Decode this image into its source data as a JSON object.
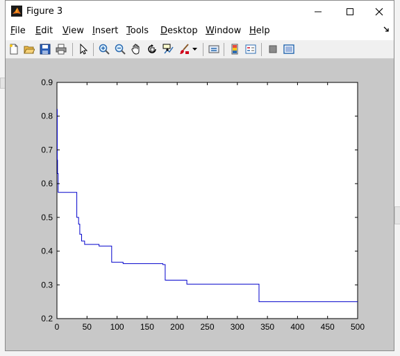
{
  "window": {
    "title": "Figure 3",
    "controls": [
      "minimize",
      "maximize",
      "close"
    ]
  },
  "menu": {
    "items": [
      {
        "label": "File",
        "mnemonic": "F",
        "rest": "ile"
      },
      {
        "label": "Edit",
        "mnemonic": "E",
        "rest": "dit"
      },
      {
        "label": "View",
        "mnemonic": "V",
        "rest": "iew"
      },
      {
        "label": "Insert",
        "mnemonic": "I",
        "rest": "nsert"
      },
      {
        "label": "Tools",
        "mnemonic": "T",
        "rest": "ools"
      },
      {
        "label": "Desktop",
        "mnemonic": "D",
        "rest": "esktop"
      },
      {
        "label": "Window",
        "mnemonic": "W",
        "rest": "indow"
      },
      {
        "label": "Help",
        "mnemonic": "H",
        "rest": "elp"
      }
    ]
  },
  "toolbar": {
    "icons": [
      "new-figure-icon",
      "open-file-icon",
      "save-icon",
      "print-icon",
      "edit-plot-arrow-icon",
      "zoom-in-icon",
      "zoom-out-icon",
      "pan-hand-icon",
      "rotate-3d-icon",
      "data-cursor-icon",
      "brush-icon",
      "brush-dropdown-icon",
      "link-plot-icon",
      "colorbar-icon",
      "legend-icon",
      "hide-plot-tools-icon",
      "show-plot-tools-icon"
    ]
  },
  "colors": {
    "line": "#0000cc",
    "figure_bg": "#c8c8c8",
    "axes_bg": "#ffffff"
  },
  "chart_data": {
    "type": "line",
    "title": "",
    "xlabel": "",
    "ylabel": "",
    "xlim": [
      0,
      500
    ],
    "ylim": [
      0.2,
      0.9
    ],
    "xticks": [
      0,
      50,
      100,
      150,
      200,
      250,
      300,
      350,
      400,
      450,
      500
    ],
    "yticks": [
      0.2,
      0.3,
      0.4,
      0.5,
      0.6,
      0.7,
      0.8,
      0.9
    ],
    "xtick_labels": [
      "0",
      "50",
      "100",
      "150",
      "200",
      "250",
      "300",
      "350",
      "400",
      "450",
      "500"
    ],
    "ytick_labels": [
      "0.2",
      "0.3",
      "0.4",
      "0.5",
      "0.6",
      "0.7",
      "0.8",
      "0.9"
    ],
    "grid": false,
    "series": [
      {
        "x": [
          0,
          0.5,
          0.5,
          1,
          1,
          2,
          2,
          33,
          33,
          36,
          36,
          38,
          38,
          41,
          41,
          46,
          46,
          70,
          70,
          91,
          91,
          110,
          110,
          176,
          176,
          180,
          180,
          216,
          216,
          336,
          336,
          500
        ],
        "y": [
          0.82,
          0.82,
          0.67,
          0.67,
          0.63,
          0.63,
          0.574,
          0.574,
          0.5,
          0.5,
          0.48,
          0.48,
          0.45,
          0.45,
          0.43,
          0.43,
          0.42,
          0.42,
          0.415,
          0.415,
          0.367,
          0.367,
          0.363,
          0.363,
          0.36,
          0.36,
          0.314,
          0.314,
          0.302,
          0.302,
          0.25,
          0.25
        ]
      }
    ]
  }
}
